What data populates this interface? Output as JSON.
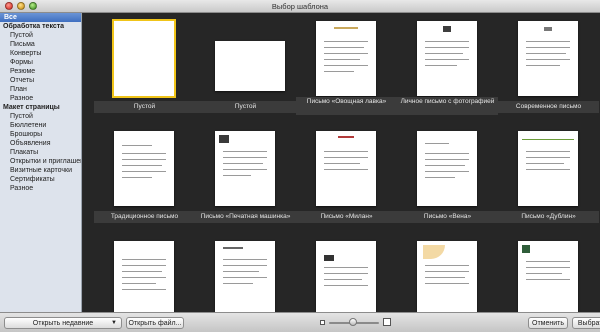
{
  "window": {
    "title": "Выбор шаблона"
  },
  "sidebar": {
    "all": "Все",
    "sections": [
      {
        "heading": "Обработка текста",
        "items": [
          "Пустой",
          "Письма",
          "Конверты",
          "Формы",
          "Резюме",
          "Отчеты",
          "План",
          "Разное"
        ]
      },
      {
        "heading": "Макет страницы",
        "items": [
          "Пустой",
          "Бюллетени",
          "Брошюры",
          "Объявления",
          "Плакаты",
          "Открытки и приглашения",
          "Визитные карточки",
          "Сертификаты",
          "Разное"
        ]
      }
    ]
  },
  "templates": [
    "Пустой",
    "Пустой",
    "Письмо «Овощная лавка»",
    "Личное письмо с фотографией",
    "Современное письмо",
    "Традиционное письмо",
    "Письмо «Печатная машинка»",
    "Письмо «Милан»",
    "Письмо «Вена»",
    "Письмо «Дублин»"
  ],
  "footer": {
    "open_recent": "Открыть недавние",
    "open_file": "Открыть файл...",
    "cancel": "Отменить",
    "choose": "Выбрать"
  },
  "colors": {
    "selection": "#f0c419",
    "sidebar_accent": "#3f6fc0"
  },
  "icons": [
    "dropdown-arrow-icon",
    "thumbnail-size-small-icon",
    "thumbnail-size-large-icon"
  ]
}
